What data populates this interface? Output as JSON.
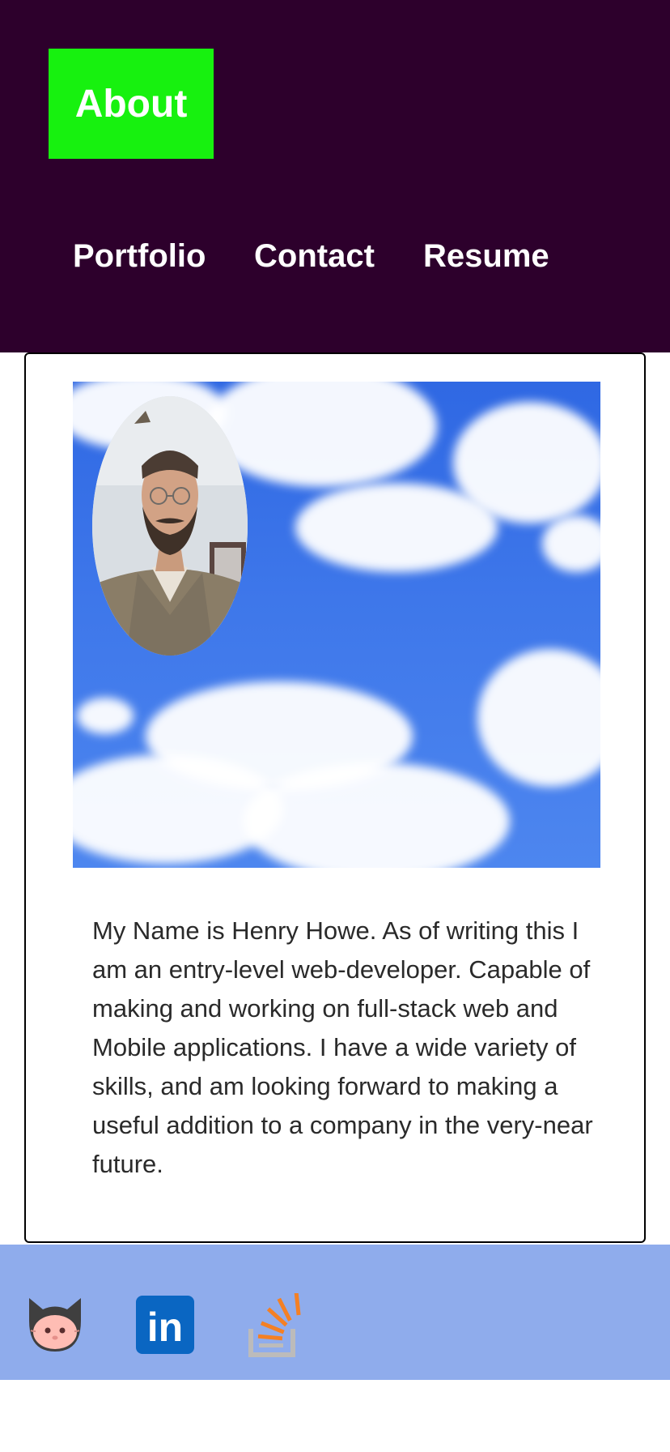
{
  "nav": {
    "active": "About",
    "links": [
      "Portfolio",
      "Contact",
      "Resume"
    ]
  },
  "bio": "My Name is Henry Howe. As of writing this I am an entry-level web-developer. Capable of making and working on full-stack web and Mobile applications. I have a wide variety of skills, and am looking forward to making a useful addition to a company in the very-near future.",
  "social": {
    "icons": [
      "github-icon",
      "linkedin-icon",
      "stackoverflow-icon"
    ],
    "linkedin_text": "in"
  },
  "colors": {
    "header_bg": "#2d002c",
    "active_nav_bg": "#17f10f",
    "footer_bg": "#8facec",
    "text": "#2a2a2a"
  }
}
